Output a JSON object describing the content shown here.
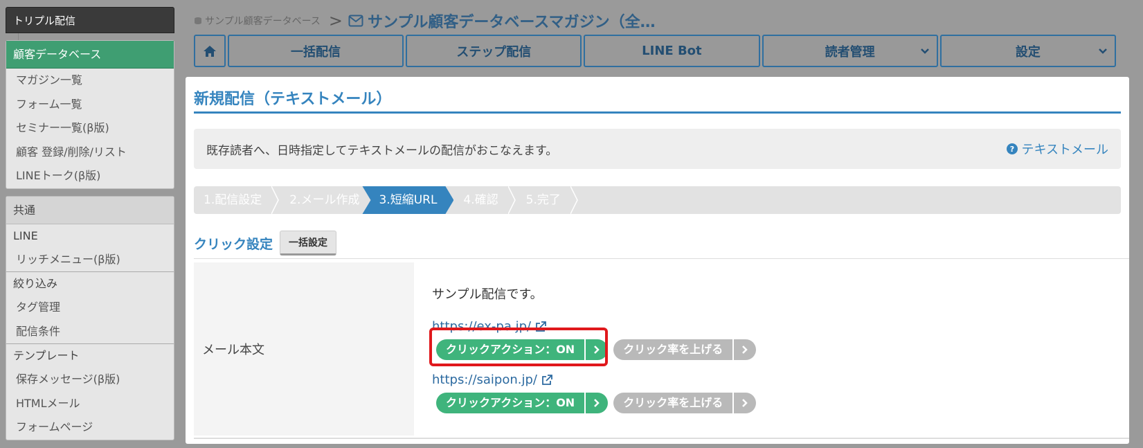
{
  "sidebar": {
    "top_label": "トリプル配信",
    "customer_db": {
      "header": "顧客データベース",
      "items": [
        "マガジン一覧",
        "フォーム一覧",
        "セミナー一覧(β版)",
        "顧客 登録/削除/リスト",
        "LINEトーク(β版)"
      ]
    },
    "common": {
      "header": "共通",
      "groups": [
        {
          "label": "LINE",
          "items": [
            "リッチメニュー(β版)"
          ]
        },
        {
          "label": "絞り込み",
          "items": [
            "タグ管理",
            "配信条件"
          ]
        },
        {
          "label": "テンプレート",
          "items": [
            "保存メッセージ(β版)",
            "HTMLメール",
            "フォームページ"
          ]
        }
      ]
    }
  },
  "breadcrumb": {
    "home": "サンプル顧客データベース",
    "separator": ">",
    "current": "サンプル顧客データベースマガジン（全…"
  },
  "topnav": {
    "items": [
      "一括配信",
      "ステップ配信",
      "LINE Bot",
      "読者管理",
      "設定"
    ]
  },
  "main": {
    "title": "新規配信（テキストメール）",
    "info_text": "既存読者へ、日時指定してテキストメールの配信がおこなえます。",
    "help_link": "テキストメール",
    "steps": [
      "1.配信設定",
      "2.メール作成",
      "3.短縮URL",
      "4.確認",
      "5.完了"
    ],
    "active_step": 2,
    "click_settings_title": "クリック設定",
    "bulk_button": "一括設定",
    "row_label": "メール本文",
    "body_text": "サンプル配信です。",
    "urls": [
      {
        "url": "https://ex-pa.jp/",
        "action_label": "クリックアクション：ON",
        "rate_label": "クリック率を上げる"
      },
      {
        "url": "https://saipon.jp/",
        "action_label": "クリックアクション：ON",
        "rate_label": "クリック率を上げる"
      }
    ]
  },
  "colors": {
    "accent": "#3584be",
    "green": "#3fb47c",
    "highlight": "#e0181c"
  }
}
